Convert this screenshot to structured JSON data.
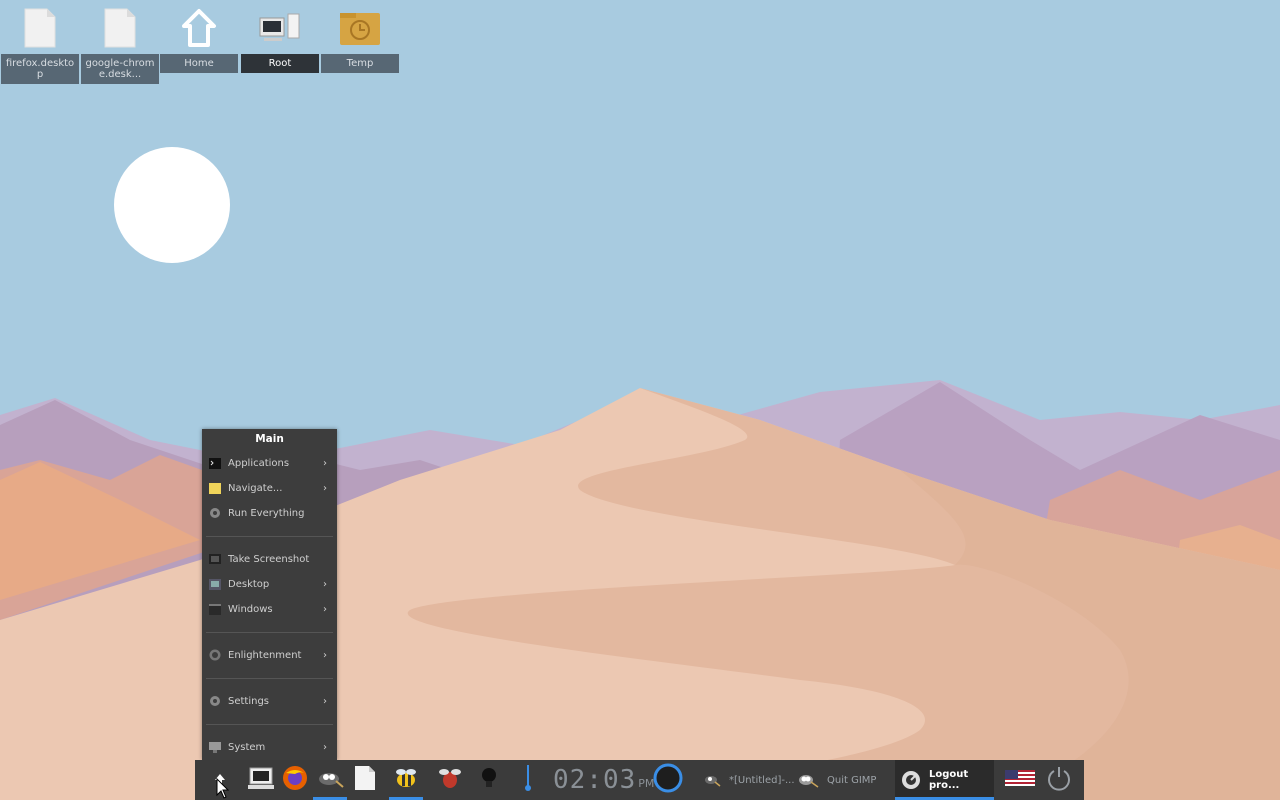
{
  "desktop": {
    "icons": [
      {
        "label": "firefox.desktop",
        "icon": "file-icon"
      },
      {
        "label": "google-chrome.desk...",
        "icon": "file-icon"
      },
      {
        "label": "Home",
        "icon": "home-icon"
      },
      {
        "label": "Root",
        "icon": "computer-icon"
      },
      {
        "label": "Temp",
        "icon": "folder-clock-icon"
      }
    ]
  },
  "menu": {
    "title": "Main",
    "items": [
      {
        "label": "Applications",
        "icon": "terminal-icon",
        "submenu": true
      },
      {
        "label": "Navigate...",
        "icon": "folder-icon",
        "submenu": true
      },
      {
        "label": "Run Everything",
        "icon": "gear-icon",
        "submenu": false
      },
      {
        "label": "Take Screenshot",
        "icon": "screenshot-icon",
        "submenu": false
      },
      {
        "label": "Desktop",
        "icon": "desktop-icon",
        "submenu": true
      },
      {
        "label": "Windows",
        "icon": "windows-icon",
        "submenu": true
      },
      {
        "label": "Enlightenment",
        "icon": "enlightenment-icon",
        "submenu": true
      },
      {
        "label": "Settings",
        "icon": "gear-icon",
        "submenu": true
      },
      {
        "label": "System",
        "icon": "monitor-icon",
        "submenu": true
      }
    ]
  },
  "taskbar": {
    "clock": {
      "time": "02:03",
      "ampm": "PM"
    },
    "tasks": [
      {
        "label": "*[Untitled]-...",
        "icon": "gimp-icon"
      },
      {
        "label": "Quit GIMP",
        "icon": "gimp-icon"
      },
      {
        "label": "Logout pro...",
        "icon": "enlightenment-icon",
        "active": true
      }
    ]
  },
  "colors": {
    "sky": "#a8cbe0",
    "panel": "#3b3b3b",
    "accent": "#3a8ee6"
  }
}
